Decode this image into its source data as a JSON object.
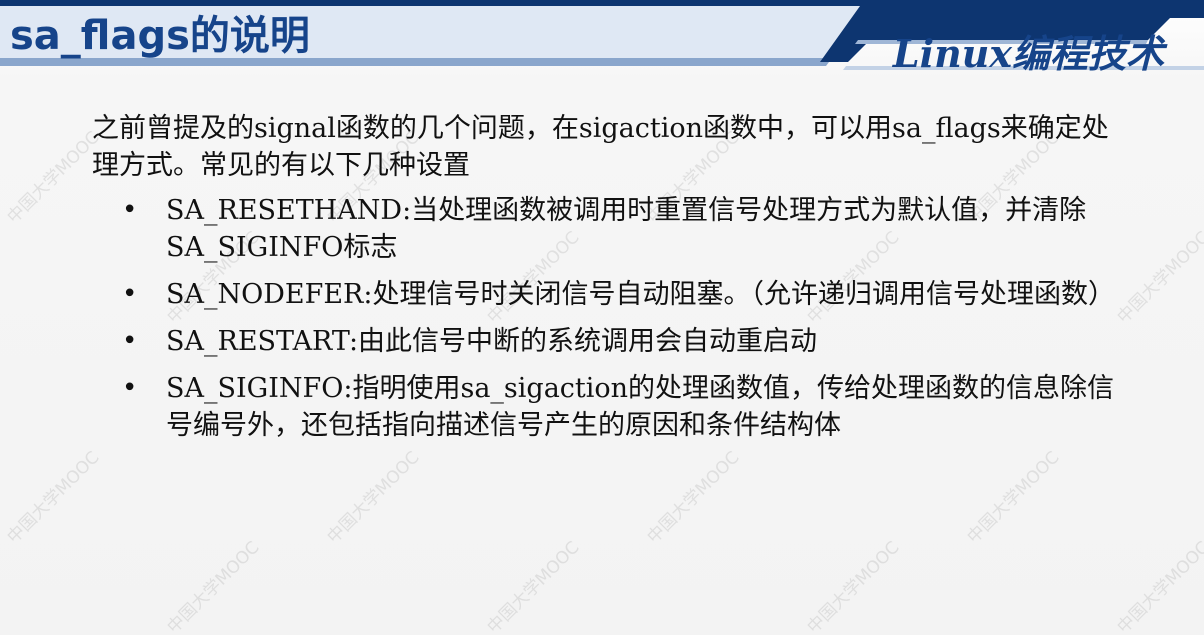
{
  "header": {
    "title": "sa_flags的说明",
    "brand": "Linux编程技术"
  },
  "watermark": {
    "text": "中国大学MOOC"
  },
  "content": {
    "intro": "之前曾提及的signal函数的几个问题，在sigaction函数中，可以用sa_flags来确定处理方式。常见的有以下几种设置",
    "bullets": [
      {
        "marker": "•",
        "text": "SA_RESETHAND:当处理函数被调用时重置信号处理方式为默认值，并清除SA_SIGINFO标志"
      },
      {
        "marker": "•",
        "text": "SA_NODEFER:处理信号时关闭信号自动阻塞。（允许递归调用信号处理函数）"
      },
      {
        "marker": "•",
        "text": "SA_RESTART:由此信号中断的系统调用会自动重启动"
      },
      {
        "marker": "•",
        "text": "SA_SIGINFO:指明使用sa_sigaction的处理函数值，传给处理函数的信息除信号编号外，还包括指向描述信号产生的原因和条件结构体"
      }
    ]
  },
  "colors": {
    "title_blue": "#16448a",
    "header_navy": "#0d3570",
    "header_stripe": "#7f9cc4",
    "text": "#111111"
  }
}
